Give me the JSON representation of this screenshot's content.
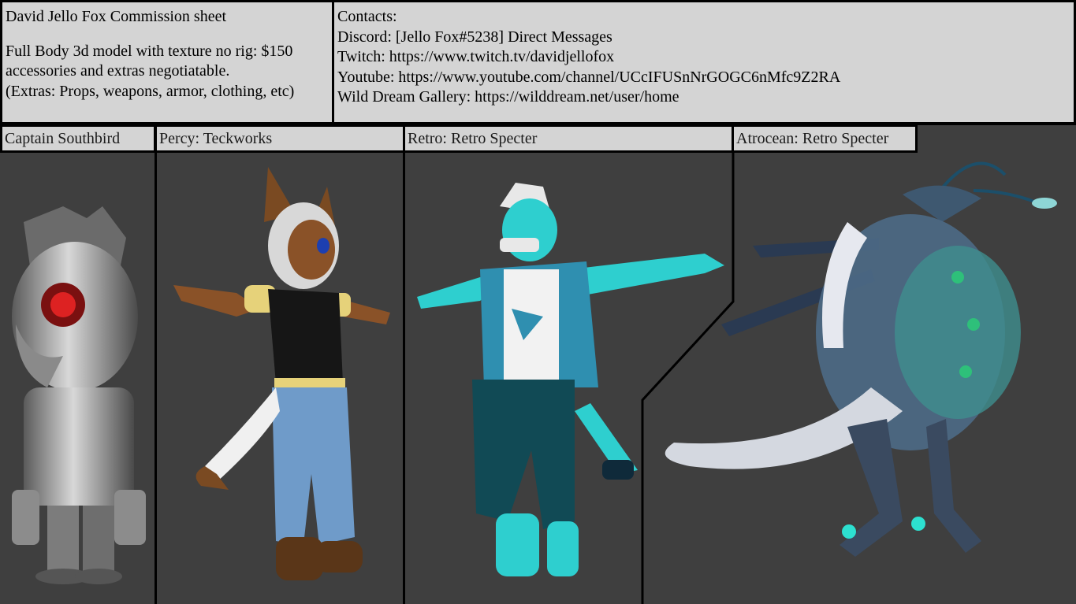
{
  "info": {
    "title": "David Jello Fox Commission sheet",
    "line1": "Full Body 3d model with texture no rig: $150",
    "line2": "accessories and extras negotiatable.",
    "line3": "(Extras: Props, weapons, armor, clothing, etc)"
  },
  "contacts": {
    "heading": "Contacts:",
    "discord": "Discord: [Jello Fox#5238] Direct Messages",
    "twitch": "Twitch: https://www.twitch.tv/davidjellofox",
    "youtube": "Youtube: https://www.youtube.com/channel/UCcIFUSnNrGOGC6nMfc9Z2RA",
    "gallery": "Wild Dream Gallery: https://wilddream.net/user/home"
  },
  "panels": [
    {
      "label": "Captain Southbird",
      "icon": "robot-bird-figure"
    },
    {
      "label": "Percy: Teckworks",
      "icon": "cat-girl-figure"
    },
    {
      "label": "Retro: Retro Specter",
      "icon": "teal-dragon-figure"
    },
    {
      "label": "Atrocean: Retro Specter",
      "icon": "sea-creature-figure"
    }
  ],
  "colors": {
    "panel_bg": "#3f3f3f",
    "label_bg": "#d4d4d4",
    "border": "#000000"
  }
}
